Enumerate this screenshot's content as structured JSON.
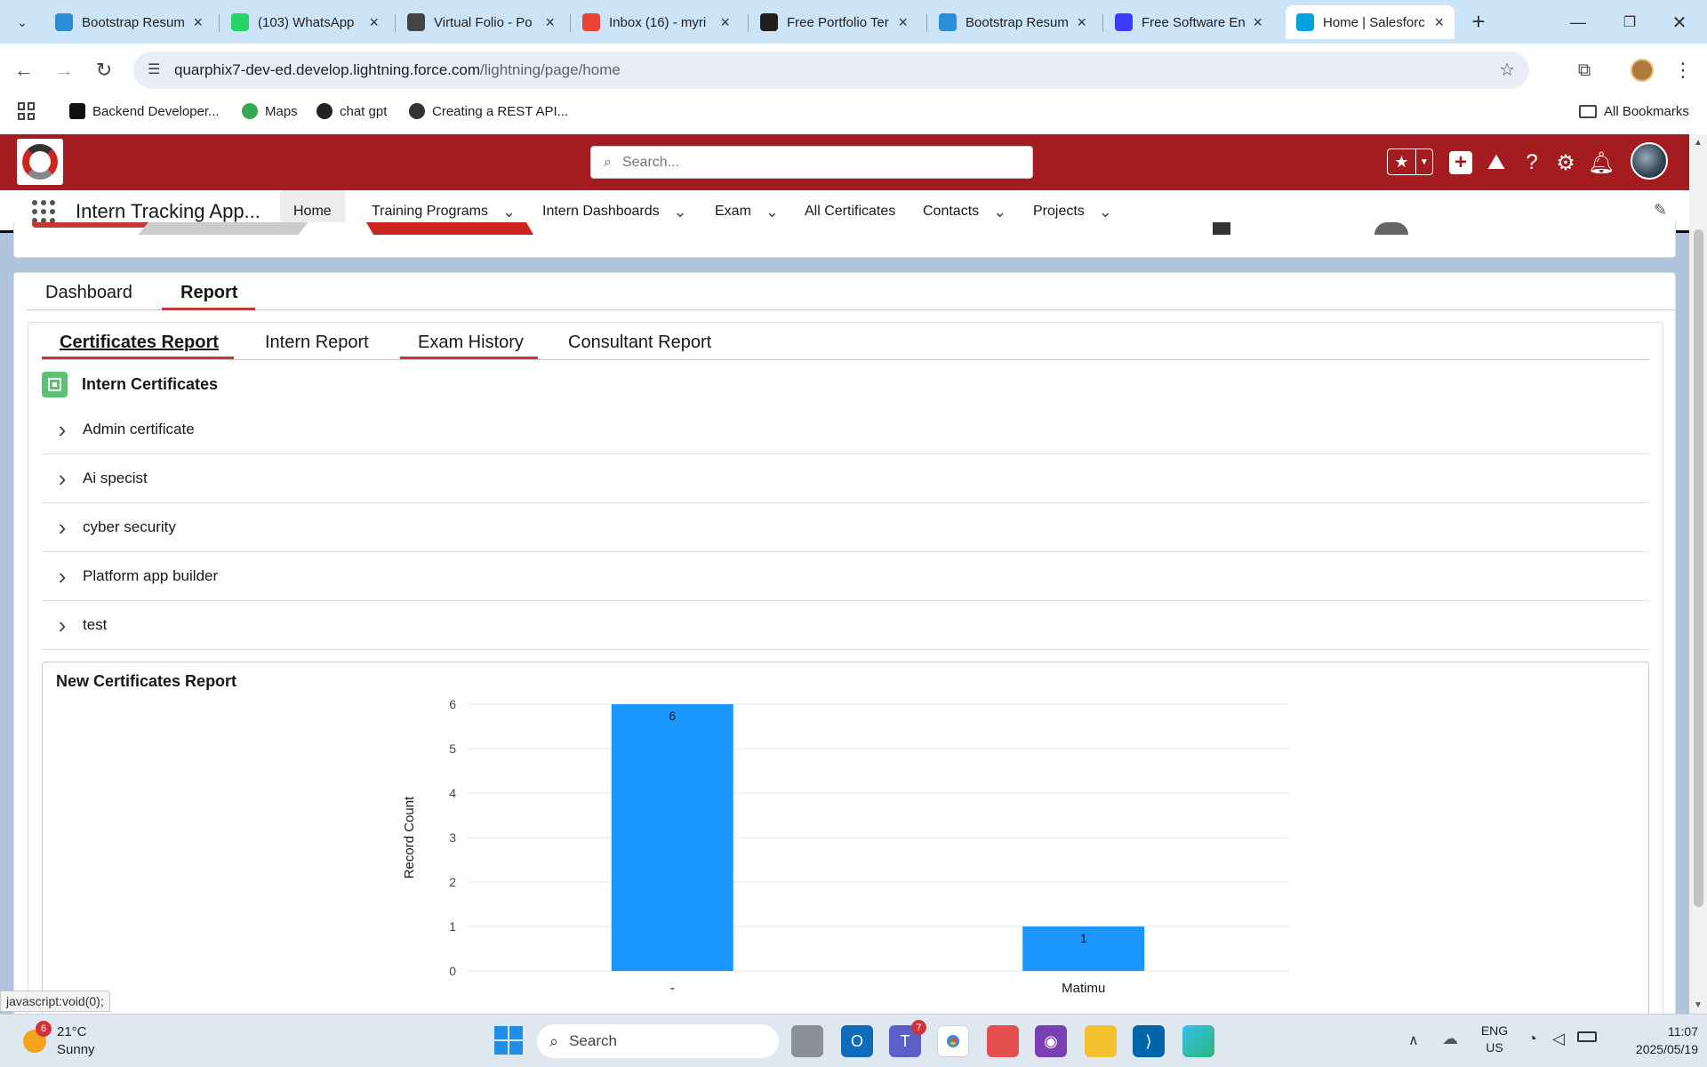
{
  "browser": {
    "tabs": [
      {
        "title": "Bootstrap Resum",
        "icon": "bootstrap-icon",
        "color": "#2b8fd8"
      },
      {
        "title": "(103) WhatsApp",
        "icon": "whatsapp-icon",
        "color": "#25d366"
      },
      {
        "title": "Virtual Folio - Po",
        "icon": "v-icon",
        "color": "#444444"
      },
      {
        "title": "Inbox (16) - myri",
        "icon": "gmail-icon",
        "color": "#ea4335"
      },
      {
        "title": "Free Portfolio Ter",
        "icon": "openai-icon",
        "color": "#1f1f1f"
      },
      {
        "title": "Bootstrap Resum",
        "icon": "bootstrap-icon",
        "color": "#2b8fd8"
      },
      {
        "title": "Free Software En",
        "icon": "t-icon",
        "color": "#3b3bff"
      },
      {
        "title": "Home | Salesforc",
        "icon": "salesforce-icon",
        "color": "#00a1e0",
        "active": true
      }
    ],
    "url_host": "quarphix7-dev-ed.develop.lightning.force.com",
    "url_path": "/lightning/page/home",
    "bookmarks": [
      "Backend Developer...",
      "Maps",
      "chat gpt",
      "Creating a REST API..."
    ],
    "all_bookmarks": "All Bookmarks",
    "status_url": "javascript:void(0);"
  },
  "sf": {
    "search_placeholder": "Search...",
    "app_name": "Intern Tracking App...",
    "nav": [
      {
        "label": "Home",
        "dropdown": false,
        "active": true
      },
      {
        "label": "Training Programs",
        "dropdown": true
      },
      {
        "label": "Intern Dashboards",
        "dropdown": true
      },
      {
        "label": "Exam",
        "dropdown": true
      },
      {
        "label": "All Certificates",
        "dropdown": false
      },
      {
        "label": "Contacts",
        "dropdown": true
      },
      {
        "label": "Projects",
        "dropdown": true
      }
    ],
    "main_tabs": [
      "Dashboard",
      "Report"
    ],
    "report_tabs": [
      "Certificates Report",
      "Intern Report",
      "Exam History",
      "Consultant Report"
    ],
    "section_title": "Intern Certificates",
    "certificates": [
      "Admin certificate",
      "Ai specist",
      "cyber security",
      "Platform app builder",
      "test"
    ],
    "report_title": "New Certificates Report"
  },
  "chart_data": {
    "type": "bar",
    "categories": [
      "-",
      "Matimu"
    ],
    "values": [
      6,
      1
    ],
    "ylabel": "Record Count",
    "ylim": [
      0,
      6
    ],
    "yticks": [
      0,
      1,
      2,
      3,
      4,
      5,
      6
    ],
    "grid": true,
    "color": "#1b96ff"
  },
  "taskbar": {
    "weather_temp": "21°C",
    "weather_desc": "Sunny",
    "weather_badge": "6",
    "search_label": "Search",
    "teams_badge": "7",
    "lang_top": "ENG",
    "lang_bottom": "US",
    "time": "11:07",
    "date": "2025/05/19"
  }
}
